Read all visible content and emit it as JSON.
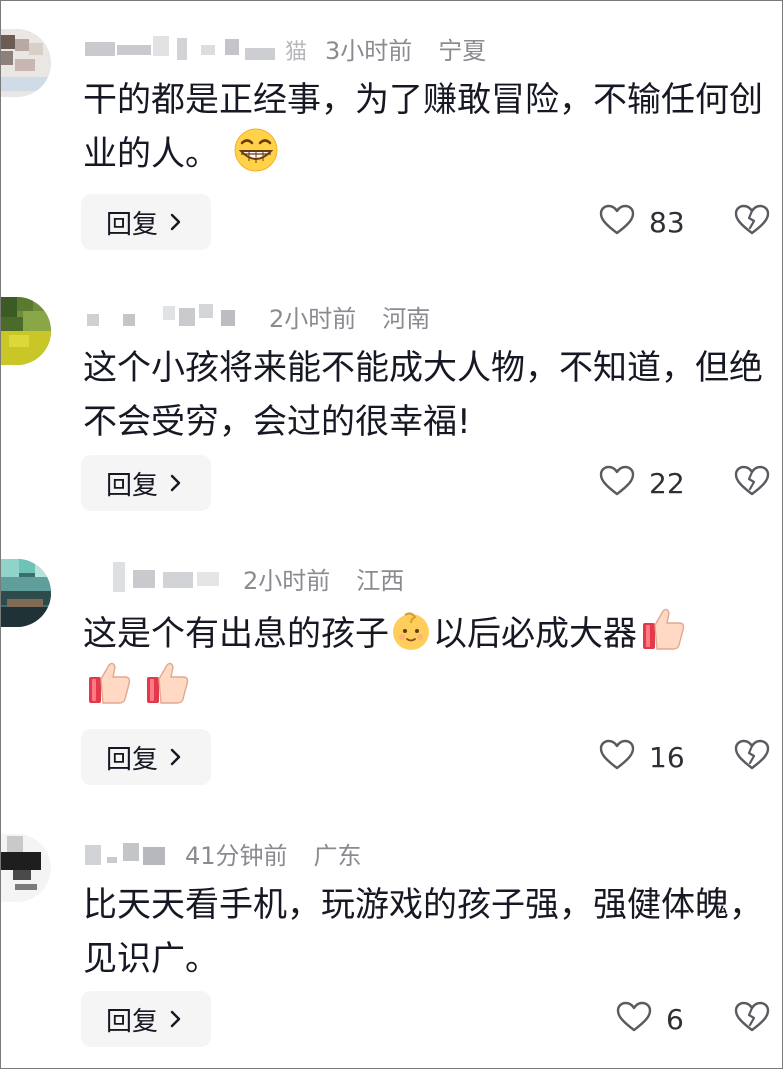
{
  "comments": [
    {
      "time": "3小时前",
      "location": "宁夏",
      "username_tail": "猫",
      "text": "干的都是正经事，为了赚敢冒险，不输任何创业的人。",
      "emoji": [
        "grinning-face-emoji"
      ],
      "reply_label": "回复",
      "likes": "83"
    },
    {
      "time": "2小时前",
      "location": "河南",
      "username_tail": "",
      "text": "这个小孩将来能不能成大人物，不知道，但绝不会受穷，会过的很幸福!",
      "emoji": [],
      "reply_label": "回复",
      "likes": "22"
    },
    {
      "time": "2小时前",
      "location": "江西",
      "username_tail": "",
      "text_part1": "这是个有出息的孩子",
      "text_part2": "以后必成大器",
      "emoji": [
        "baby-emoji",
        "thumbs-up-emoji",
        "thumbs-up-emoji",
        "thumbs-up-emoji"
      ],
      "reply_label": "回复",
      "likes": "16"
    },
    {
      "time": "41分钟前",
      "location": "广东",
      "username_tail": "",
      "text": "比天天看手机，玩游戏的孩子强，强健体魄，见识广。",
      "emoji": [],
      "reply_label": "回复",
      "likes": "6"
    }
  ],
  "colors": {
    "text": "#161823",
    "meta": "#8a8b91",
    "reply_bg": "#f5f5f5",
    "icon": "#5a5b61"
  }
}
